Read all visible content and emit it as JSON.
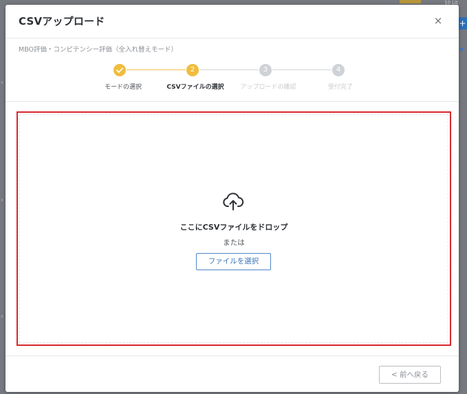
{
  "background": {
    "corner_text": "10 Lit",
    "plus_label": "+",
    "side_mark": "x"
  },
  "modal": {
    "title": "CSVアップロード",
    "close_glyph": "×",
    "subtitle": "MBO評価・コンピテンシー評価（全入れ替えモード）"
  },
  "stepper": {
    "steps": [
      {
        "number": "1",
        "label": "モードの選択",
        "state": "done"
      },
      {
        "number": "2",
        "label": "CSVファイルの選択",
        "state": "active"
      },
      {
        "number": "3",
        "label": "アップロードの確認",
        "state": "pending"
      },
      {
        "number": "4",
        "label": "受付完了",
        "state": "pending"
      }
    ]
  },
  "dropzone": {
    "icon": "cloud-upload-icon",
    "drop_text": "ここにCSVファイルをドロップ",
    "or_text": "または",
    "select_button": "ファイルを選択"
  },
  "footer": {
    "back_button": "< 前へ戻る"
  },
  "colors": {
    "accent": "#f0bd3c",
    "dropzone_border": "#d7262c",
    "link_blue": "#3a74b8"
  }
}
